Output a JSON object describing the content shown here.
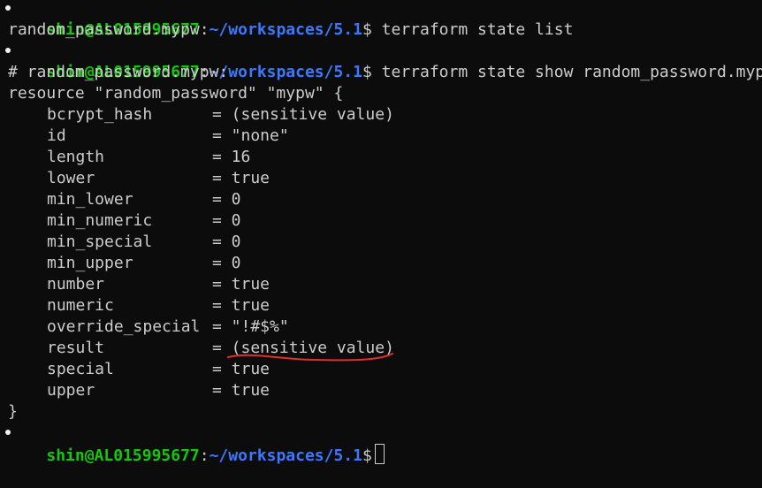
{
  "prompt": {
    "user": "shin@AL015995677",
    "colon": ":",
    "path": "~/workspaces/5.1",
    "dollar": "$"
  },
  "commands": {
    "list": " terraform state list",
    "show": " terraform state show random_password.mypw"
  },
  "list_output": "random_password.mypw",
  "show_output": {
    "comment": "# random_password.mypw:",
    "resource_header": "resource \"random_password\" \"mypw\" {",
    "attributes": [
      {
        "key": "bcrypt_hash",
        "value": "= (sensitive value)"
      },
      {
        "key": "id",
        "value": "= \"none\""
      },
      {
        "key": "length",
        "value": "= 16"
      },
      {
        "key": "lower",
        "value": "= true"
      },
      {
        "key": "min_lower",
        "value": "= 0"
      },
      {
        "key": "min_numeric",
        "value": "= 0"
      },
      {
        "key": "min_special",
        "value": "= 0"
      },
      {
        "key": "min_upper",
        "value": "= 0"
      },
      {
        "key": "number",
        "value": "= true"
      },
      {
        "key": "numeric",
        "value": "= true"
      },
      {
        "key": "override_special",
        "value": "= \"!#$%\""
      },
      {
        "key": "result",
        "value": "= (sensitive value)"
      },
      {
        "key": "special",
        "value": "= true"
      },
      {
        "key": "upper",
        "value": "= true"
      }
    ],
    "closing_brace": "}"
  },
  "colors": {
    "background": "#0c0c0c",
    "foreground": "#cccccc",
    "user": "#16c60c",
    "path": "#3b78ff",
    "annotation": "#e0302a"
  }
}
